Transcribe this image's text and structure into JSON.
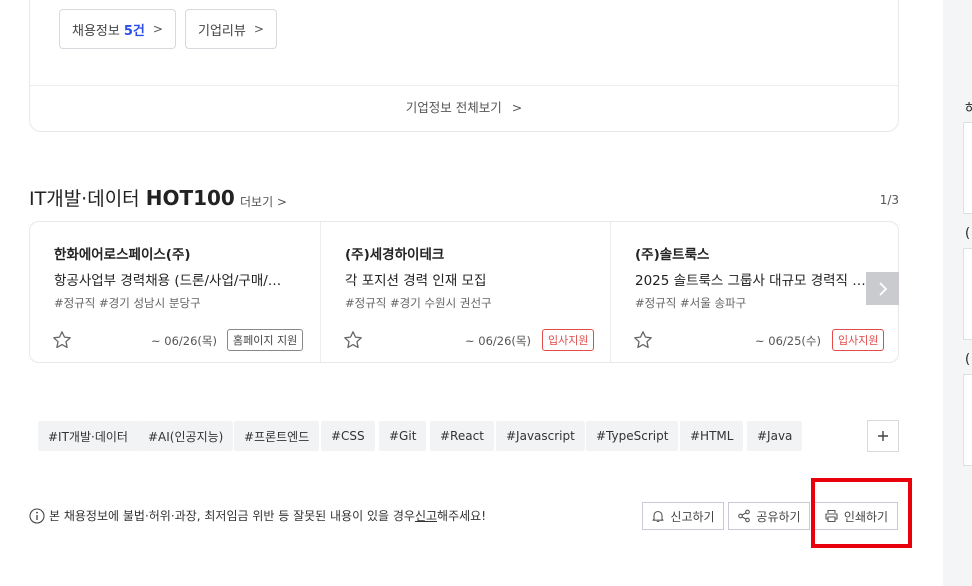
{
  "company_section": {
    "jobs_label": "채용정보",
    "jobs_count": "5건",
    "reviews_label": "기업리뷰",
    "view_all": "기업정보 전체보기"
  },
  "hot_section": {
    "title_prefix": "IT개발·데이터",
    "title_bold": "HOT100",
    "more": "더보기 >",
    "pager": "1/3",
    "cards": [
      {
        "company": "한화에어로스페이스(주)",
        "title": "항공사업부 경력채용 (드론/사업/구매/…",
        "tags": "#정규직  #경기 성남시 분당구",
        "deadline": "~ 06/26(목)",
        "apply": "홈페이지 지원"
      },
      {
        "company": "(주)세경하이테크",
        "title": "각 포지션 경력 인재 모집",
        "tags": "#정규직  #경기 수원시 권선구",
        "deadline": "~ 06/26(목)",
        "apply": "입사지원"
      },
      {
        "company": "(주)솔트룩스",
        "title": "2025 솔트룩스 그룹사 대규모 경력직 …",
        "tags": "#정규직  #서울 송파구",
        "deadline": "~ 06/25(수)",
        "apply": "입사지원"
      }
    ]
  },
  "keyword_tags": [
    "#IT개발·데이터",
    "#AI(인공지능)",
    "#프론트엔드",
    "#CSS",
    "#Git",
    "#React",
    "#Javascript",
    "#TypeScript",
    "#HTML",
    "#Java"
  ],
  "notice": {
    "text_before": "본 채용정보에 불법·허위·과장, 최저임금 위반 등 잘못된 내용이 있을 경우 ",
    "link": "신고",
    "text_after": "해주세요!"
  },
  "actions": {
    "report": "신고하기",
    "share": "공유하기",
    "print": "인쇄하기"
  },
  "right_panel": {
    "marks": [
      "하",
      "(",
      "("
    ]
  },
  "colors": {
    "accent_blue": "#2b4de8",
    "apply_red": "#e34b4b",
    "highlight": "#e8000b"
  }
}
